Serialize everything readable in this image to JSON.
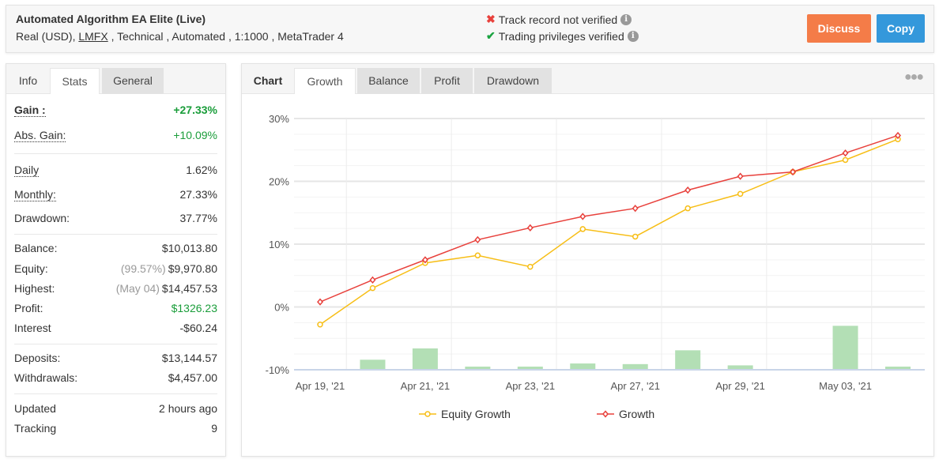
{
  "header": {
    "title": "Automated Algorithm EA Elite (Live)",
    "subtitle_pre": "Real (USD), ",
    "broker": "LMFX",
    "subtitle_post": " , Technical , Automated , 1:1000 , MetaTrader 4",
    "verify": [
      {
        "icon": "x-icon",
        "text": "Track record not verified",
        "color": "#e8413c"
      },
      {
        "icon": "check-icon",
        "text": "Trading privileges verified",
        "color": "#1aa340"
      }
    ],
    "discuss": "Discuss",
    "copy": "Copy",
    "discuss_color": "#f47c48",
    "copy_color": "#3498db"
  },
  "left": {
    "tabs": [
      "Info",
      "Stats",
      "General"
    ],
    "active_tab": "Stats",
    "rows": [
      {
        "k": "Gain :",
        "v": "+27.33%"
      },
      {
        "k": "Abs. Gain:",
        "v": "+10.09%"
      },
      {
        "k": "Daily",
        "v": "1.62%"
      },
      {
        "k": "Monthly:",
        "v": "27.33%"
      },
      {
        "k": "Drawdown:",
        "v": "37.77%"
      },
      {
        "k": "Balance:",
        "v": "$10,013.80"
      },
      {
        "k": "Equity:",
        "sub": "(99.57%)",
        "v": "$9,970.80"
      },
      {
        "k": "Highest:",
        "sub": "(May 04)",
        "v": "$14,457.53"
      },
      {
        "k": "Profit:",
        "v": "$1326.23"
      },
      {
        "k": "Interest",
        "v": "-$60.24"
      },
      {
        "k": "Deposits:",
        "v": "$13,144.57"
      },
      {
        "k": "Withdrawals:",
        "v": "$4,457.00"
      },
      {
        "k": "Updated",
        "v": "2 hours ago"
      },
      {
        "k": "Tracking",
        "v": "9"
      }
    ]
  },
  "right": {
    "tabs": [
      "Chart",
      "Growth",
      "Balance",
      "Profit",
      "Drawdown"
    ],
    "active_tab": "Growth",
    "menu_icon": "more-dots-icon"
  },
  "chart_data": {
    "type": "line",
    "ylim": [
      -10,
      30
    ],
    "yticks": [
      "30%",
      "20%",
      "10%",
      "0%",
      "-10%"
    ],
    "ytick_values": [
      30,
      20,
      10,
      0,
      -10
    ],
    "categories": [
      "Apr 19, '21",
      "",
      "Apr 21, '21",
      "",
      "Apr 23, '21",
      "",
      "Apr 27, '21",
      "",
      "Apr 29, '21",
      "",
      "May 03, '21",
      ""
    ],
    "series": [
      {
        "name": "Equity Growth",
        "color": "#f7be16",
        "marker": "circle",
        "values": [
          -2.8,
          3.0,
          7.0,
          8.2,
          6.4,
          12.4,
          11.2,
          15.7,
          18.0,
          21.5,
          23.4,
          26.7
        ]
      },
      {
        "name": "Growth",
        "color": "#e8413c",
        "marker": "diamond",
        "values": [
          0.8,
          4.3,
          7.5,
          10.7,
          12.6,
          14.4,
          15.7,
          18.6,
          20.8,
          21.5,
          24.5,
          27.3
        ]
      }
    ],
    "bars": {
      "color": "#b3dfb5",
      "base": -10,
      "tops": [
        -9.9,
        -8.4,
        -6.6,
        -9.5,
        -9.5,
        -9.0,
        -9.1,
        -6.9,
        -9.3,
        -9.9,
        -3.0,
        -9.5
      ]
    },
    "legend": "bottom",
    "grid": true
  }
}
